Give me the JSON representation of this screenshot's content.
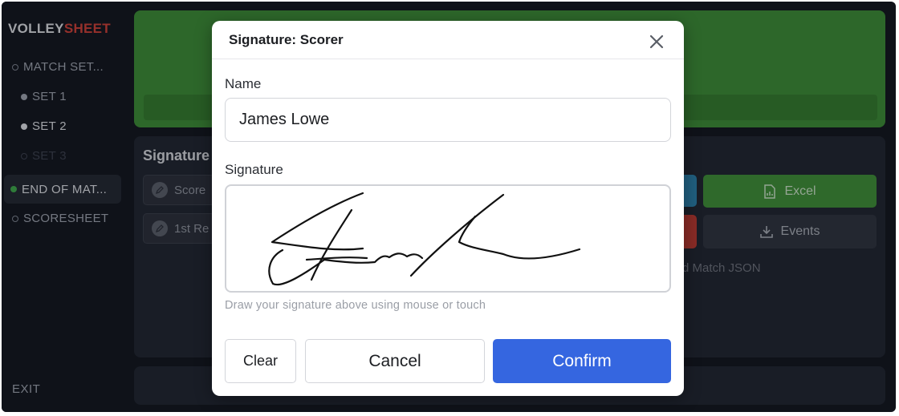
{
  "sidebar": {
    "logo_part1": "VOLLEY",
    "logo_part2": "SHEET",
    "items": [
      {
        "label": "MATCH SET..."
      },
      {
        "label": "SET 1"
      },
      {
        "label": "SET 2"
      },
      {
        "label": "SET 3"
      },
      {
        "label": "END OF MAT..."
      },
      {
        "label": "SCORESHEET"
      }
    ],
    "exit_label": "EXIT"
  },
  "background": {
    "panel_title": "Signature",
    "scorer_button": "Score",
    "referee_button": "1st Re",
    "excel_button": "Excel",
    "events_button": "Events",
    "json_text": "d Match JSON"
  },
  "modal": {
    "title": "Signature: Scorer",
    "name_label": "Name",
    "name_value": "James Lowe",
    "signature_label": "Signature",
    "hint": "Draw your signature above using mouse or touch",
    "clear_label": "Clear",
    "cancel_label": "Cancel",
    "confirm_label": "Confirm"
  },
  "colors": {
    "accent": "#3566e0",
    "logo_accent": "#c8413a",
    "green_panel": "#3d8a38"
  }
}
